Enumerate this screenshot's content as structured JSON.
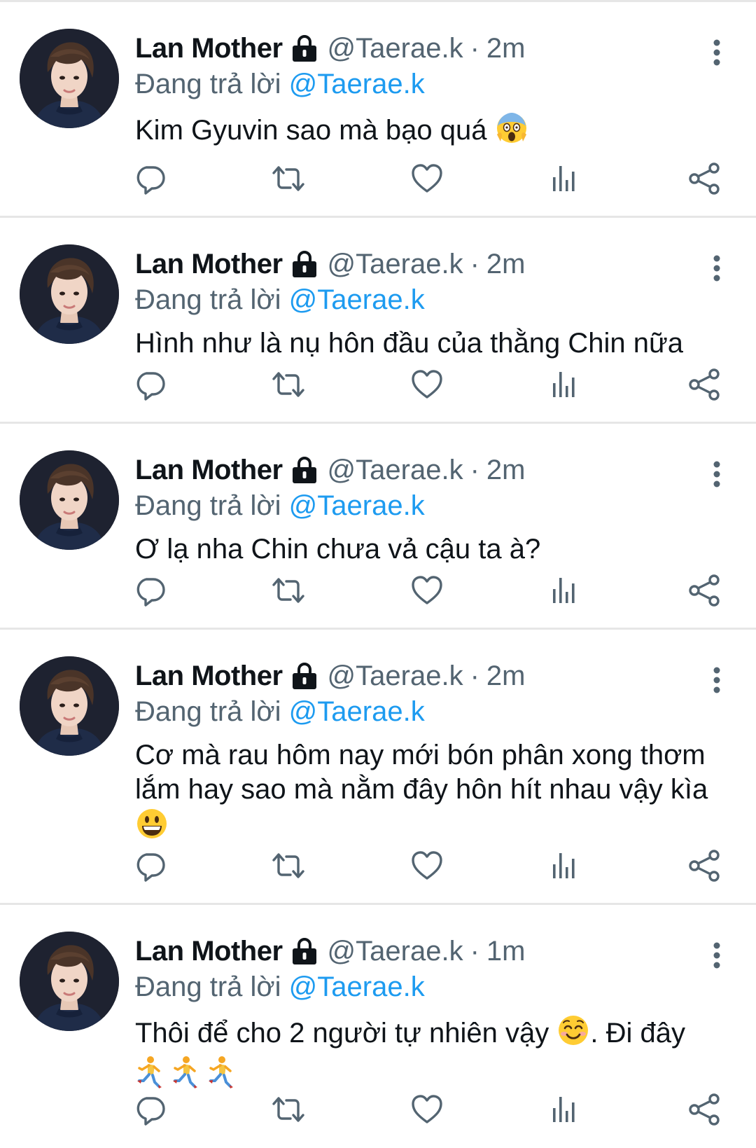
{
  "colors": {
    "text": "#0f1419",
    "secondary": "#536471",
    "mention": "#1d9bf0",
    "divider": "#e6e6e6"
  },
  "tweets": [
    {
      "name": "Lan Mother",
      "handle": "@Taerae.k",
      "separator": "·",
      "time": "2m",
      "reply_prefix": "Đang trả lời",
      "reply_to": "@Taerae.k",
      "text": "Kim Gyuvin sao mà bạo quá",
      "emoji": "face-screaming-in-fear-emoji"
    },
    {
      "name": "Lan Mother",
      "handle": "@Taerae.k",
      "separator": "·",
      "time": "2m",
      "reply_prefix": "Đang trả lời",
      "reply_to": "@Taerae.k",
      "text": "Hình như là nụ hôn đầu của thằng Chin nữa"
    },
    {
      "name": "Lan Mother",
      "handle": "@Taerae.k",
      "separator": "·",
      "time": "2m",
      "reply_prefix": "Đang trả lời",
      "reply_to": "@Taerae.k",
      "text": "Ơ lạ nha Chin chưa vả cậu ta à?"
    },
    {
      "name": "Lan Mother",
      "handle": "@Taerae.k",
      "separator": "·",
      "time": "2m",
      "reply_prefix": "Đang trả lời",
      "reply_to": "@Taerae.k",
      "text": "Cơ mà rau hôm nay mới bón phân xong thơm lắm hay sao mà nằm đây hôn hít nhau vậy kìa",
      "emoji": "grinning-face-emoji"
    },
    {
      "name": "Lan Mother",
      "handle": "@Taerae.k",
      "separator": "·",
      "time": "1m",
      "reply_prefix": "Đang trả lời",
      "reply_to": "@Taerae.k",
      "text_before": "Thôi để cho 2 người tự nhiên vậy",
      "text_after": ". Đi đây",
      "emoji": "smiling-face-emoji",
      "trailing_emoji": "person-running-emoji"
    }
  ],
  "icons": {
    "verified_lock": "lock-icon",
    "more": "more-vertical-icon",
    "reply": "reply-icon",
    "retweet": "retweet-icon",
    "like": "heart-icon",
    "views": "analytics-icon",
    "share": "share-icon"
  }
}
